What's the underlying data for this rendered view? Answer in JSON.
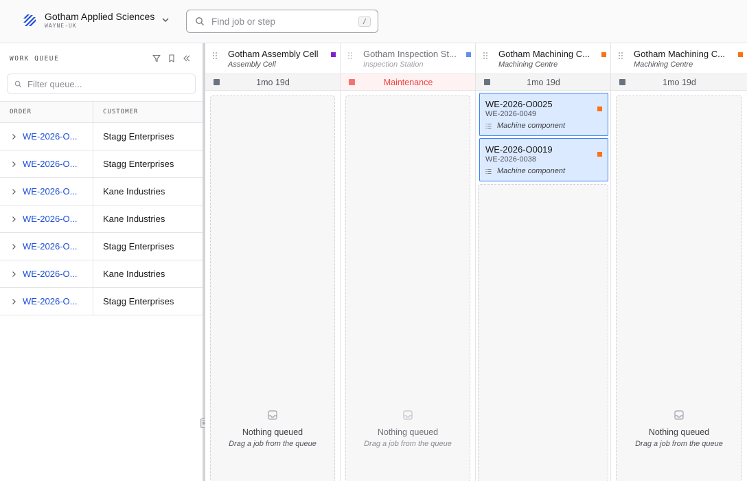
{
  "header": {
    "org_name": "Gotham Applied Sciences",
    "org_code": "WAYNE-UK",
    "search_placeholder": "Find job or step",
    "search_shortcut": "/"
  },
  "sidebar": {
    "title": "WORK QUEUE",
    "filter_placeholder": "Filter queue...",
    "columns": {
      "order": "ORDER",
      "customer": "CUSTOMER"
    },
    "rows": [
      {
        "order": "WE-2026-O...",
        "customer": "Stagg Enterprises"
      },
      {
        "order": "WE-2026-O...",
        "customer": "Stagg Enterprises"
      },
      {
        "order": "WE-2026-O...",
        "customer": "Kane Industries"
      },
      {
        "order": "WE-2026-O...",
        "customer": "Kane Industries"
      },
      {
        "order": "WE-2026-O...",
        "customer": "Stagg Enterprises"
      },
      {
        "order": "WE-2026-O...",
        "customer": "Kane Industries"
      },
      {
        "order": "WE-2026-O...",
        "customer": "Stagg Enterprises"
      }
    ]
  },
  "colors": {
    "accent": "#1d4ed8",
    "assembly": "#7e22ce",
    "inspection": "#6191e8",
    "machining": "#f97316",
    "maintenance": "#ef4444",
    "card_border": "#3b82f6",
    "card_bg": "#dbeafe"
  },
  "board": {
    "empty_title": "Nothing queued",
    "empty_sub": "Drag a job from the queue",
    "columns": [
      {
        "name": "Gotham Assembly Cell",
        "type": "Assembly Cell",
        "status": "1mo 19d",
        "swatch": "#7e22ce"
      },
      {
        "name": "Gotham Inspection St...",
        "type": "Inspection Station",
        "status": "Maintenance",
        "swatch": "#6191e8"
      },
      {
        "name": "Gotham Machining C...",
        "type": "Machining Centre",
        "status": "1mo 19d",
        "swatch": "#f97316",
        "jobs": [
          {
            "id": "WE-2026-O0025",
            "ref": "WE-2026-0049",
            "type": "Machine component"
          },
          {
            "id": "WE-2026-O0019",
            "ref": "WE-2026-0038",
            "type": "Machine component"
          }
        ]
      },
      {
        "name": "Gotham Machining C...",
        "type": "Machining Centre",
        "status": "1mo 19d",
        "swatch": "#f97316"
      }
    ]
  }
}
